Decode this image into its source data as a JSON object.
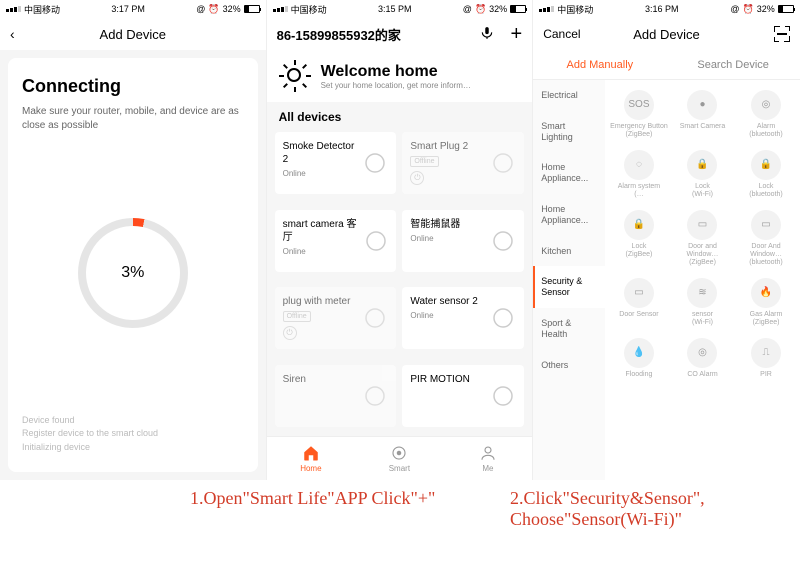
{
  "phone1": {
    "status": {
      "carrier": "中国移动",
      "time": "3:17 PM",
      "battery": "32%"
    },
    "nav": {
      "back_icon": "‹",
      "title": "Add Device"
    },
    "card": {
      "heading": "Connecting",
      "subtext": "Make sure your router, mobile, and device are as close as possible",
      "percent": "3%",
      "steps": [
        "Device found",
        "Register device to the smart cloud",
        "Initializing device"
      ]
    }
  },
  "phone2": {
    "status": {
      "carrier": "中国移动",
      "time": "3:15 PM",
      "battery": "32%"
    },
    "nav": {
      "title": "86-15899855932的家",
      "mic_icon": "mic",
      "plus_icon": "+"
    },
    "welcome": {
      "title": "Welcome home",
      "subtitle": "Set your home location, get more inform…"
    },
    "section_header": "All devices",
    "devices": [
      {
        "name": "Smoke Detector 2",
        "status": "Online",
        "dim": false,
        "icon": "smoke"
      },
      {
        "name": "Smart Plug 2",
        "status": "Offline",
        "dim": true,
        "icon": "plug",
        "power": true
      },
      {
        "name": "smart camera 客厅",
        "status": "Online",
        "dim": false,
        "icon": "camera"
      },
      {
        "name": "智能捕鼠器",
        "status": "Online",
        "dim": false,
        "icon": "mouse"
      },
      {
        "name": "plug with meter",
        "status": "Offline",
        "dim": true,
        "icon": "plug",
        "power": true
      },
      {
        "name": "Water sensor 2",
        "status": "Online",
        "dim": false,
        "icon": "water"
      },
      {
        "name": "Siren",
        "status": "",
        "dim": true,
        "icon": "siren"
      },
      {
        "name": "PIR MOTION",
        "status": "",
        "dim": false,
        "icon": "pir"
      }
    ],
    "tabs": [
      {
        "label": "Home",
        "active": true
      },
      {
        "label": "Smart",
        "active": false
      },
      {
        "label": "Me",
        "active": false
      }
    ]
  },
  "phone3": {
    "status": {
      "carrier": "中国移动",
      "time": "3:16 PM",
      "battery": "32%"
    },
    "nav": {
      "cancel": "Cancel",
      "title": "Add Device",
      "scan_icon": "scan"
    },
    "seg_tabs": [
      {
        "label": "Add Manually",
        "active": true
      },
      {
        "label": "Search Device",
        "active": false
      }
    ],
    "categories": [
      "Electrical",
      "Smart Lighting",
      "Home Appliance...",
      "Home Appliance...",
      "Kitchen",
      "Security & Sensor",
      "Sport & Health",
      "Others"
    ],
    "active_category_index": 5,
    "products": [
      {
        "name": "Emergency Button",
        "sub": "(ZigBee)",
        "icon": "SOS"
      },
      {
        "name": "Smart Camera",
        "sub": "",
        "icon": "●"
      },
      {
        "name": "Alarm",
        "sub": "(bluetooth)",
        "icon": "◎"
      },
      {
        "name": "Alarm system",
        "sub": "(…",
        "icon": "◌"
      },
      {
        "name": "Lock",
        "sub": "(Wi-Fi)",
        "icon": "🔒"
      },
      {
        "name": "Lock",
        "sub": "(bluetooth)",
        "icon": "🔒"
      },
      {
        "name": "Lock",
        "sub": "(ZigBee)",
        "icon": "🔒"
      },
      {
        "name": "Door and Window…",
        "sub": "(ZigBee)",
        "icon": "▭"
      },
      {
        "name": "Door And Window…",
        "sub": "(bluetooth)",
        "icon": "▭"
      },
      {
        "name": "Door Sensor",
        "sub": "",
        "icon": "▭"
      },
      {
        "name": "sensor",
        "sub": "(Wi-Fi)",
        "icon": "≋"
      },
      {
        "name": "Gas Alarm",
        "sub": "(ZigBee)",
        "icon": "🔥"
      },
      {
        "name": "Flooding",
        "sub": "",
        "icon": "💧"
      },
      {
        "name": "CO Alarm",
        "sub": "",
        "icon": "◎"
      },
      {
        "name": "PIR",
        "sub": "",
        "icon": "⎍"
      }
    ]
  },
  "captions": {
    "cap1": "1.Open\"Smart Life\"APP Click\"+\"",
    "cap2": "2.Click\"Security&Sensor\", Choose\"Sensor(Wi-Fi)\""
  },
  "status_icons": {
    "alarm": "⏰",
    "at": "@"
  }
}
